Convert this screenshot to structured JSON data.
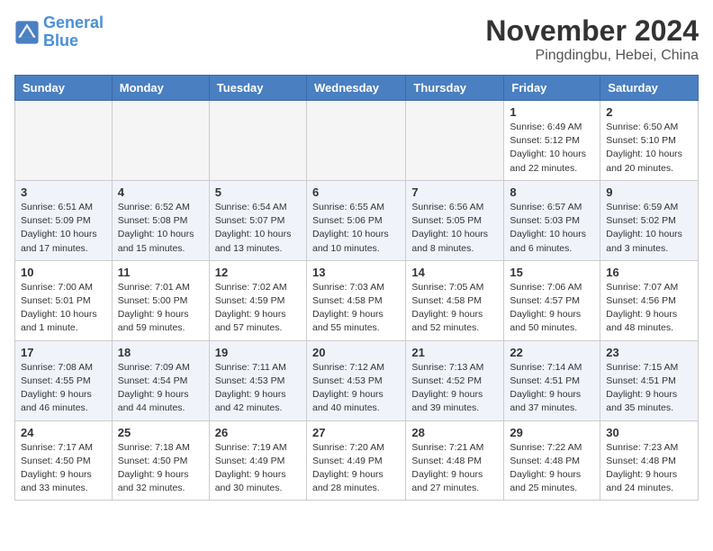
{
  "header": {
    "logo_line1": "General",
    "logo_line2": "Blue",
    "month": "November 2024",
    "location": "Pingdingbu, Hebei, China"
  },
  "weekdays": [
    "Sunday",
    "Monday",
    "Tuesday",
    "Wednesday",
    "Thursday",
    "Friday",
    "Saturday"
  ],
  "weeks": [
    [
      {
        "day": "",
        "info": ""
      },
      {
        "day": "",
        "info": ""
      },
      {
        "day": "",
        "info": ""
      },
      {
        "day": "",
        "info": ""
      },
      {
        "day": "",
        "info": ""
      },
      {
        "day": "1",
        "info": "Sunrise: 6:49 AM\nSunset: 5:12 PM\nDaylight: 10 hours and 22 minutes."
      },
      {
        "day": "2",
        "info": "Sunrise: 6:50 AM\nSunset: 5:10 PM\nDaylight: 10 hours and 20 minutes."
      }
    ],
    [
      {
        "day": "3",
        "info": "Sunrise: 6:51 AM\nSunset: 5:09 PM\nDaylight: 10 hours and 17 minutes."
      },
      {
        "day": "4",
        "info": "Sunrise: 6:52 AM\nSunset: 5:08 PM\nDaylight: 10 hours and 15 minutes."
      },
      {
        "day": "5",
        "info": "Sunrise: 6:54 AM\nSunset: 5:07 PM\nDaylight: 10 hours and 13 minutes."
      },
      {
        "day": "6",
        "info": "Sunrise: 6:55 AM\nSunset: 5:06 PM\nDaylight: 10 hours and 10 minutes."
      },
      {
        "day": "7",
        "info": "Sunrise: 6:56 AM\nSunset: 5:05 PM\nDaylight: 10 hours and 8 minutes."
      },
      {
        "day": "8",
        "info": "Sunrise: 6:57 AM\nSunset: 5:03 PM\nDaylight: 10 hours and 6 minutes."
      },
      {
        "day": "9",
        "info": "Sunrise: 6:59 AM\nSunset: 5:02 PM\nDaylight: 10 hours and 3 minutes."
      }
    ],
    [
      {
        "day": "10",
        "info": "Sunrise: 7:00 AM\nSunset: 5:01 PM\nDaylight: 10 hours and 1 minute."
      },
      {
        "day": "11",
        "info": "Sunrise: 7:01 AM\nSunset: 5:00 PM\nDaylight: 9 hours and 59 minutes."
      },
      {
        "day": "12",
        "info": "Sunrise: 7:02 AM\nSunset: 4:59 PM\nDaylight: 9 hours and 57 minutes."
      },
      {
        "day": "13",
        "info": "Sunrise: 7:03 AM\nSunset: 4:58 PM\nDaylight: 9 hours and 55 minutes."
      },
      {
        "day": "14",
        "info": "Sunrise: 7:05 AM\nSunset: 4:58 PM\nDaylight: 9 hours and 52 minutes."
      },
      {
        "day": "15",
        "info": "Sunrise: 7:06 AM\nSunset: 4:57 PM\nDaylight: 9 hours and 50 minutes."
      },
      {
        "day": "16",
        "info": "Sunrise: 7:07 AM\nSunset: 4:56 PM\nDaylight: 9 hours and 48 minutes."
      }
    ],
    [
      {
        "day": "17",
        "info": "Sunrise: 7:08 AM\nSunset: 4:55 PM\nDaylight: 9 hours and 46 minutes."
      },
      {
        "day": "18",
        "info": "Sunrise: 7:09 AM\nSunset: 4:54 PM\nDaylight: 9 hours and 44 minutes."
      },
      {
        "day": "19",
        "info": "Sunrise: 7:11 AM\nSunset: 4:53 PM\nDaylight: 9 hours and 42 minutes."
      },
      {
        "day": "20",
        "info": "Sunrise: 7:12 AM\nSunset: 4:53 PM\nDaylight: 9 hours and 40 minutes."
      },
      {
        "day": "21",
        "info": "Sunrise: 7:13 AM\nSunset: 4:52 PM\nDaylight: 9 hours and 39 minutes."
      },
      {
        "day": "22",
        "info": "Sunrise: 7:14 AM\nSunset: 4:51 PM\nDaylight: 9 hours and 37 minutes."
      },
      {
        "day": "23",
        "info": "Sunrise: 7:15 AM\nSunset: 4:51 PM\nDaylight: 9 hours and 35 minutes."
      }
    ],
    [
      {
        "day": "24",
        "info": "Sunrise: 7:17 AM\nSunset: 4:50 PM\nDaylight: 9 hours and 33 minutes."
      },
      {
        "day": "25",
        "info": "Sunrise: 7:18 AM\nSunset: 4:50 PM\nDaylight: 9 hours and 32 minutes."
      },
      {
        "day": "26",
        "info": "Sunrise: 7:19 AM\nSunset: 4:49 PM\nDaylight: 9 hours and 30 minutes."
      },
      {
        "day": "27",
        "info": "Sunrise: 7:20 AM\nSunset: 4:49 PM\nDaylight: 9 hours and 28 minutes."
      },
      {
        "day": "28",
        "info": "Sunrise: 7:21 AM\nSunset: 4:48 PM\nDaylight: 9 hours and 27 minutes."
      },
      {
        "day": "29",
        "info": "Sunrise: 7:22 AM\nSunset: 4:48 PM\nDaylight: 9 hours and 25 minutes."
      },
      {
        "day": "30",
        "info": "Sunrise: 7:23 AM\nSunset: 4:48 PM\nDaylight: 9 hours and 24 minutes."
      }
    ]
  ]
}
